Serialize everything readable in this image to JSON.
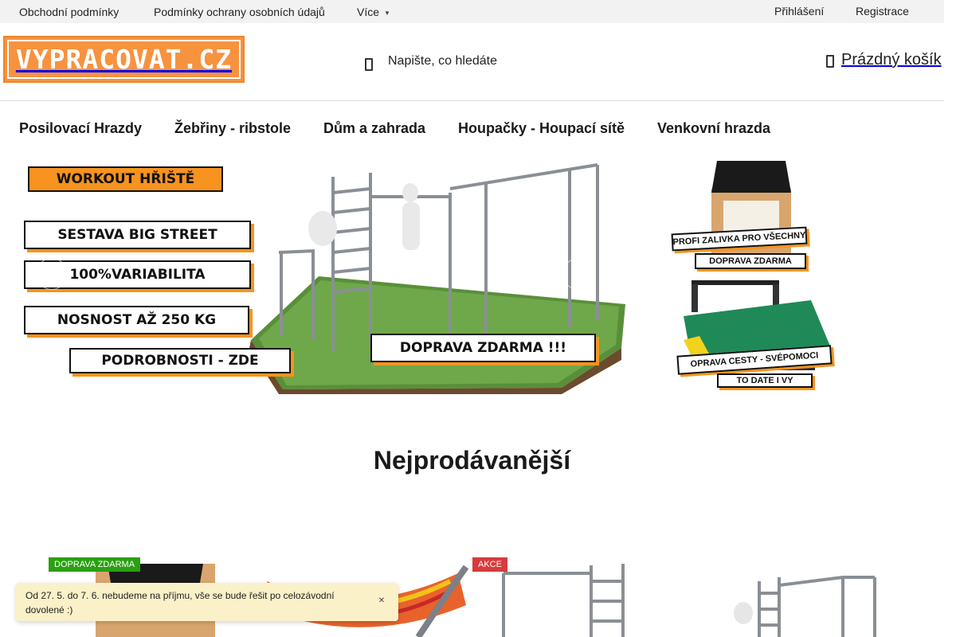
{
  "topbar": {
    "terms": "Obchodní podmínky",
    "privacy": "Podmínky ochrany osobních údajů",
    "more": "Více",
    "login": "Přihlášení",
    "register": "Registrace"
  },
  "header": {
    "logo_text": "VYPRACOVAT.CZ",
    "search_placeholder": "Napište, co hledáte",
    "cart_label": "Prázdný košík"
  },
  "nav": {
    "items": [
      {
        "label": "Posilovací Hrazdy"
      },
      {
        "label": "Žebřiny - ribstole"
      },
      {
        "label": "Dům a zahrada"
      },
      {
        "label": "Houpačky - Houpací sítě"
      },
      {
        "label": "Venkovní hrazda"
      }
    ]
  },
  "banner": {
    "title": "WORKOUT HŘIŠTĚ",
    "tags": [
      "SESTAVA BIG STREET",
      "100%VARIABILITA",
      "NOSNOST AŽ 250 KG",
      "PODROBNOSTI - ZDE",
      "DOPRAVA ZDARMA !!!"
    ]
  },
  "promo": {
    "tags": [
      "PROFI ZALIVKA PRO VŠECHNY",
      "DOPRAVA ZDARMA",
      "OPRAVA CESTY - SVÉPOMOCI",
      "TO DATE I VY"
    ]
  },
  "section": {
    "title": "Nejprodávanější"
  },
  "products": [
    {
      "flag": "DOPRAVA ZDARMA",
      "flag_color": "#2aa012"
    },
    {
      "flag": ""
    },
    {
      "flag": "AKCE",
      "flag_color": "#d83b3b"
    },
    {
      "flag": ""
    }
  ],
  "notice": {
    "text": "Od 27. 5. do 7. 6. nebudeme na příjmu, vše se bude řešit po celozávodní dovolené :)"
  },
  "colors": {
    "brand_orange": "#f7933f",
    "topbar_bg": "#f2f2f2",
    "notice_bg": "#fbf1c8"
  }
}
